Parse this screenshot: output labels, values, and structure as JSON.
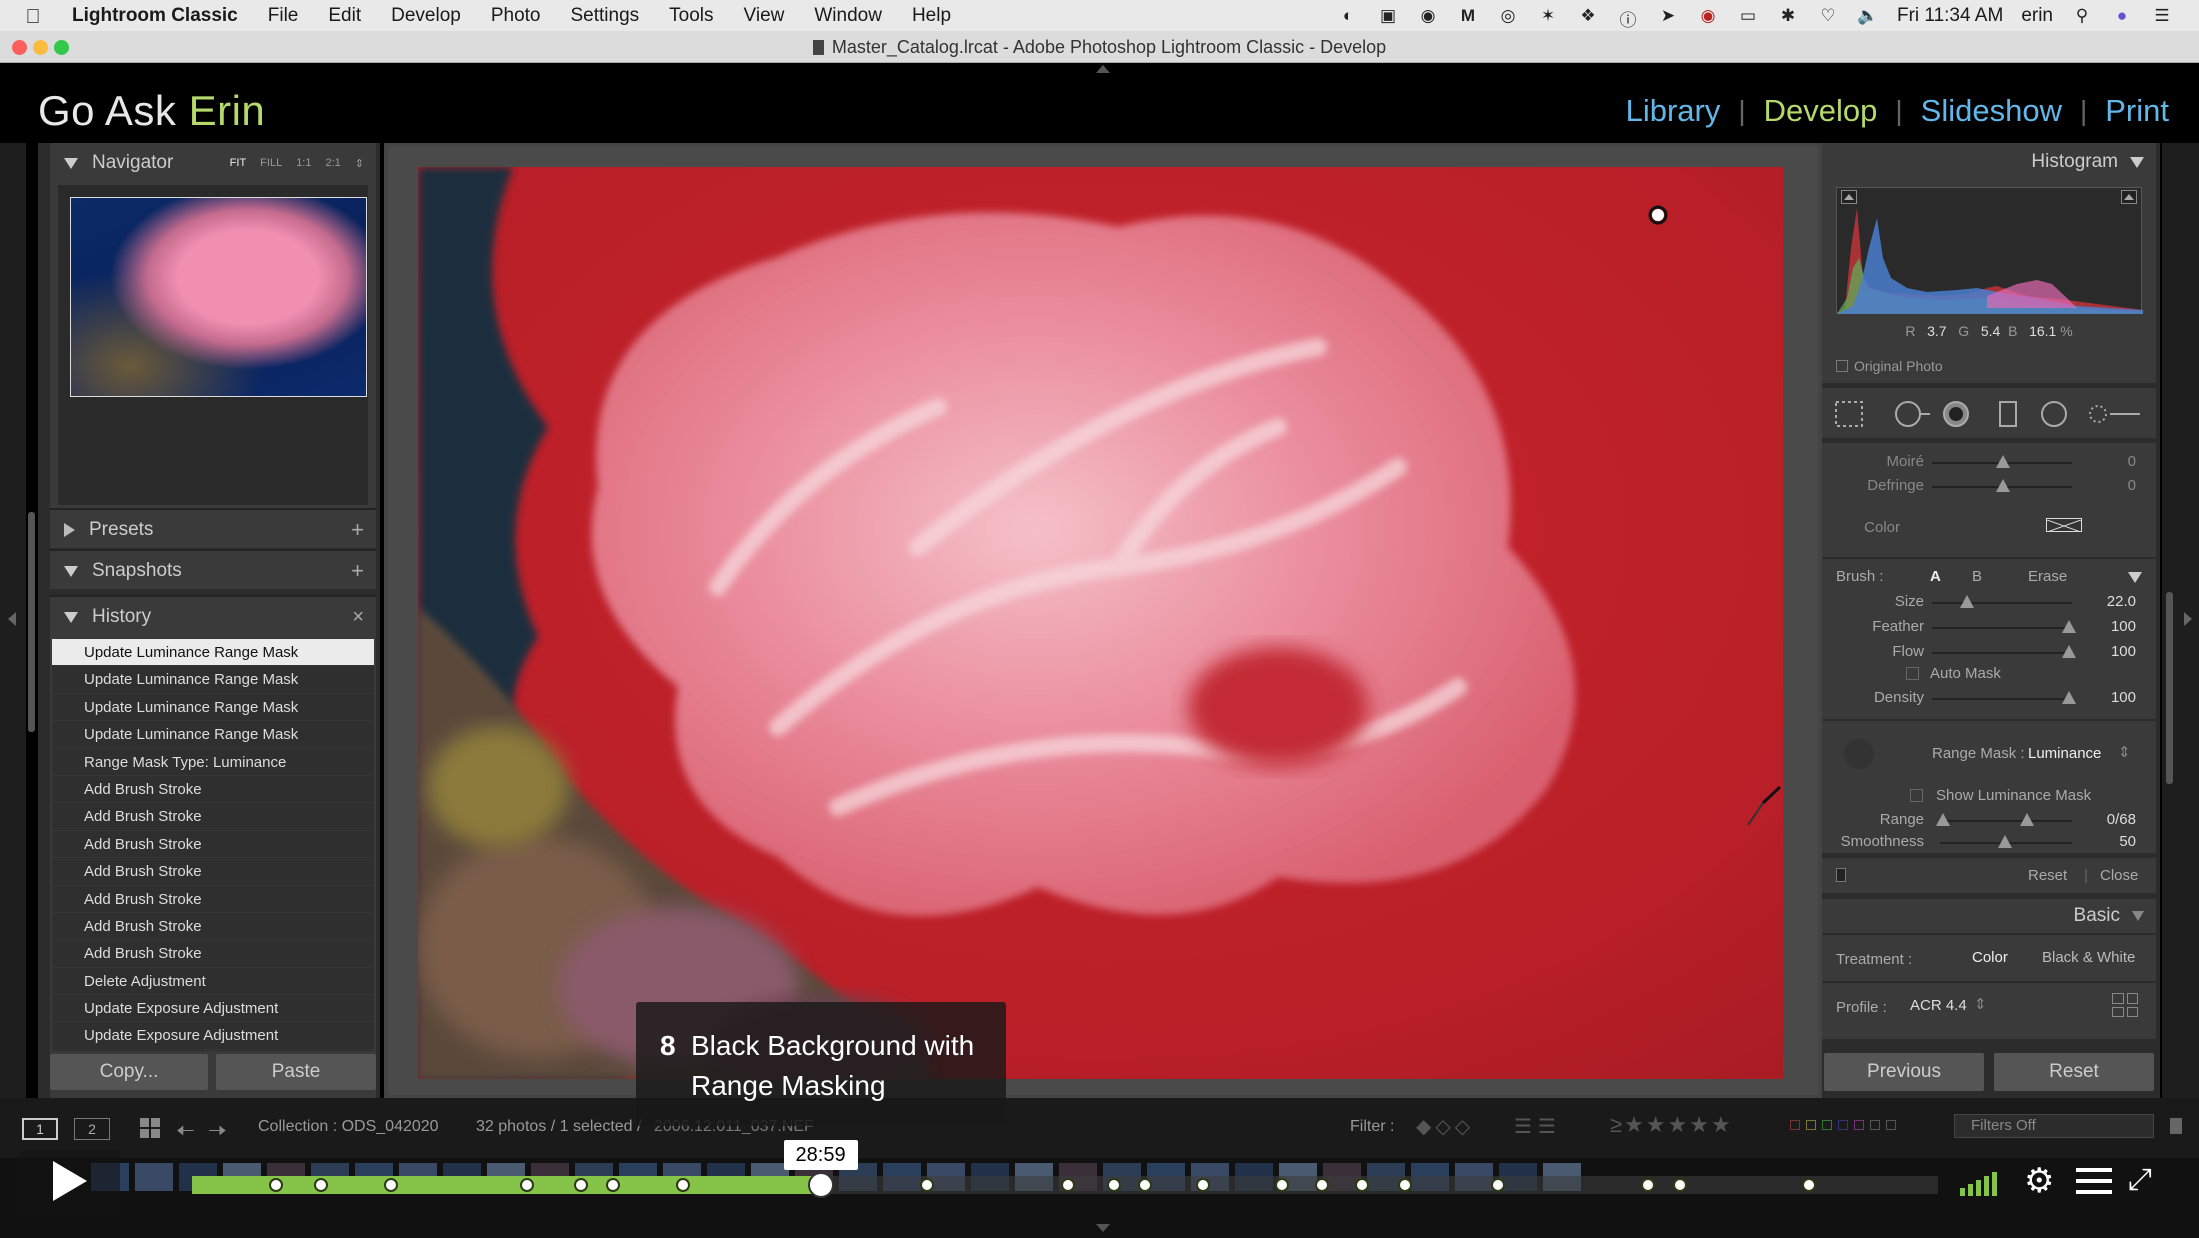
{
  "menubar": {
    "app": "Lightroom Classic",
    "items": [
      "File",
      "Edit",
      "Develop",
      "Photo",
      "Settings",
      "Tools",
      "View",
      "Window",
      "Help"
    ],
    "clock": "Fri 11:34 AM",
    "user": "erin"
  },
  "window": {
    "title": "Master_Catalog.lrcat - Adobe Photoshop Lightroom Classic - Develop"
  },
  "identity": {
    "first": "Go Ask ",
    "second": "Erin"
  },
  "modules": {
    "items": [
      "Library",
      "Develop",
      "Slideshow",
      "Print"
    ],
    "colors": {
      "Library": "#62b7e8",
      "Develop": "#b5d96b",
      "Slideshow": "#62b7e8",
      "Print": "#62b7e8"
    }
  },
  "navigator": {
    "title": "Navigator",
    "zoom": [
      "FIT",
      "FILL",
      "1:1",
      "2:1"
    ]
  },
  "presets": {
    "title": "Presets",
    "add": "+"
  },
  "snapshots": {
    "title": "Snapshots",
    "add": "+"
  },
  "history": {
    "title": "History",
    "clear": "×",
    "items": [
      "Update Luminance Range Mask",
      "Update Luminance Range Mask",
      "Update Luminance Range Mask",
      "Update Luminance Range Mask",
      "Range Mask Type: Luminance",
      "Add Brush Stroke",
      "Add Brush Stroke",
      "Add Brush Stroke",
      "Add Brush Stroke",
      "Add Brush Stroke",
      "Add Brush Stroke",
      "Add Brush Stroke",
      "Delete Adjustment",
      "Update Exposure Adjustment",
      "Update Exposure Adjustment"
    ]
  },
  "left_buttons": {
    "copy": "Copy...",
    "paste": "Paste"
  },
  "histogram": {
    "title": "Histogram",
    "r_label": "R",
    "r": "3.7",
    "g_label": "G",
    "g": "5.4",
    "b_label": "B",
    "b": "16.1",
    "pct": "%",
    "original": "Original Photo"
  },
  "brush_panel": {
    "moire": "Moiré",
    "moire_val": "0",
    "defringe": "Defringe",
    "defringe_val": "0",
    "color": "Color",
    "brush": "Brush :",
    "a": "A",
    "b": "B",
    "erase": "Erase",
    "size": "Size",
    "size_val": "22.0",
    "feather": "Feather",
    "feather_val": "100",
    "flow": "Flow",
    "flow_val": "100",
    "automask": "Auto Mask",
    "density": "Density",
    "density_val": "100",
    "range_mask_label": "Range Mask :",
    "range_mask": "Luminance",
    "show_mask": "Show Luminance Mask",
    "range": "Range",
    "range_val": "0/68",
    "smoothness": "Smoothness",
    "smoothness_val": "50",
    "reset": "Reset",
    "close": "Close"
  },
  "basic": {
    "title": "Basic",
    "treatment": "Treatment :",
    "color": "Color",
    "bw": "Black & White",
    "profile": "Profile :",
    "profile_val": "ACR 4.4"
  },
  "right_buttons": {
    "previous": "Previous",
    "reset": "Reset"
  },
  "filmstrip_bar": {
    "screen1": "1",
    "screen2": "2",
    "collection": "Collection : ODS_042020",
    "count": "32 photos / 1 selected / ",
    "filename": "2006.12.011_037.NEF",
    "filter": "Filter :",
    "filters_off": "Filters Off"
  },
  "caption": {
    "num": "8",
    "line1": "Black Background with",
    "line2": "Range Masking"
  },
  "player": {
    "time": "28:59",
    "progress": 0.36
  }
}
